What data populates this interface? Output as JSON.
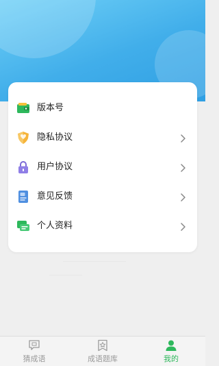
{
  "menu": {
    "items": [
      {
        "id": "version",
        "label": "版本号",
        "icon": "wallet-icon",
        "has_arrow": false
      },
      {
        "id": "privacy",
        "label": "隐私协议",
        "icon": "shield-icon",
        "has_arrow": true
      },
      {
        "id": "user-agreement",
        "label": "用户协议",
        "icon": "lock-icon",
        "has_arrow": true
      },
      {
        "id": "feedback",
        "label": "意见反馈",
        "icon": "document-icon",
        "has_arrow": true
      },
      {
        "id": "profile",
        "label": "个人资料",
        "icon": "chat-icon",
        "has_arrow": true
      }
    ]
  },
  "tabbar": {
    "tabs": [
      {
        "label": "猜成语",
        "icon": "message-icon",
        "active": false
      },
      {
        "label": "成语题库",
        "icon": "bookmark-star-icon",
        "active": false
      },
      {
        "label": "我的",
        "icon": "person-icon",
        "active": true
      }
    ]
  },
  "colors": {
    "header_light": "#6fd0f7",
    "header_dark": "#2f9fe3",
    "accent_green": "#2eb85c",
    "inactive_gray": "#9a9a9a"
  }
}
